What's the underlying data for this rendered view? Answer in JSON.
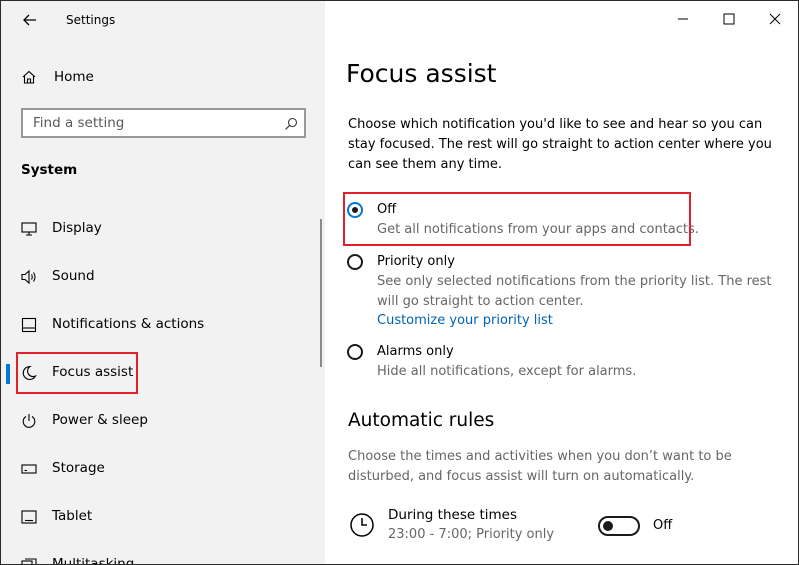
{
  "window": {
    "title": "Settings"
  },
  "sidebar": {
    "home_label": "Home",
    "search_placeholder": "Find a setting",
    "section_label": "System",
    "items": [
      {
        "label": "Display",
        "icon": "monitor-icon"
      },
      {
        "label": "Sound",
        "icon": "speaker-icon"
      },
      {
        "label": "Notifications & actions",
        "icon": "notification-icon"
      },
      {
        "label": "Focus assist",
        "icon": "moon-icon",
        "selected": true
      },
      {
        "label": "Power & sleep",
        "icon": "power-icon"
      },
      {
        "label": "Storage",
        "icon": "storage-icon"
      },
      {
        "label": "Tablet",
        "icon": "tablet-icon"
      },
      {
        "label": "Multitasking",
        "icon": "multitasking-icon"
      }
    ]
  },
  "main": {
    "title": "Focus assist",
    "description": "Choose which notification you'd like to see and hear so you can stay focused. The rest will go straight to action center where you can see them any time.",
    "options": [
      {
        "title": "Off",
        "subtitle": "Get all notifications from your apps and contacts.",
        "checked": true
      },
      {
        "title": "Priority only",
        "subtitle": "See only selected notifications from the priority list. The rest will go straight to action center.",
        "link": "Customize your priority list",
        "checked": false
      },
      {
        "title": "Alarms only",
        "subtitle": "Hide all notifications, except for alarms.",
        "checked": false
      }
    ],
    "automatic_rules": {
      "heading": "Automatic rules",
      "description": "Choose the times and activities when you don’t want to be disturbed, and focus assist will turn on automatically.",
      "rules": [
        {
          "title": "During these times",
          "subtitle": "23:00 - 7:00; Priority only",
          "toggle_state": "Off",
          "on": false,
          "icon": "clock-icon"
        }
      ]
    }
  },
  "colors": {
    "accent": "#0078d7",
    "link": "#0063b1",
    "highlight": "#e0202a",
    "sidebar_bg": "#f2f2f2"
  }
}
